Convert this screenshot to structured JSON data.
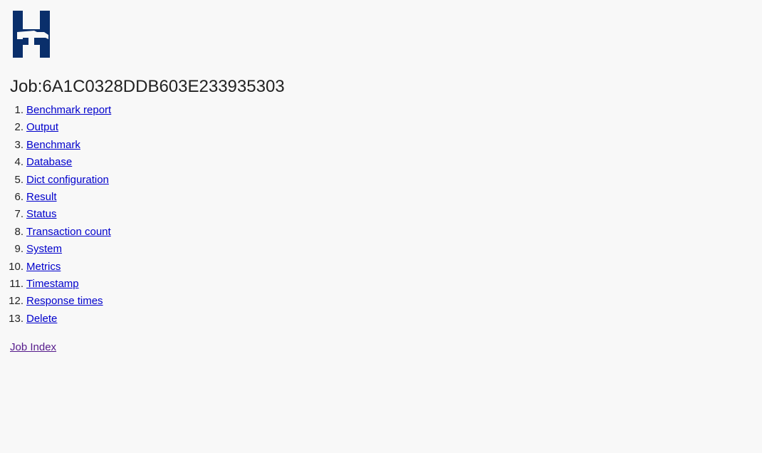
{
  "page": {
    "logo_icon": "hammer-h-logo-icon",
    "logo_color": "#0a2f6b",
    "link_color": "#0000cc",
    "visited_link_color": "#551a8b"
  },
  "job": {
    "title": "Job:6A1C0328DDB603E233935303"
  },
  "links": [
    {
      "num": "1.",
      "label": "Benchmark report"
    },
    {
      "num": "2.",
      "label": "Output"
    },
    {
      "num": "3.",
      "label": "Benchmark"
    },
    {
      "num": "4.",
      "label": "Database"
    },
    {
      "num": "5.",
      "label": "Dict configuration"
    },
    {
      "num": "6.",
      "label": "Result"
    },
    {
      "num": "7.",
      "label": "Status"
    },
    {
      "num": "8.",
      "label": "Transaction count"
    },
    {
      "num": "9.",
      "label": "System"
    },
    {
      "num": "10.",
      "label": "Metrics"
    },
    {
      "num": "11.",
      "label": "Timestamp"
    },
    {
      "num": "12.",
      "label": "Response times"
    },
    {
      "num": "13.",
      "label": "Delete"
    }
  ],
  "footer": {
    "job_index_label": "Job Index"
  }
}
